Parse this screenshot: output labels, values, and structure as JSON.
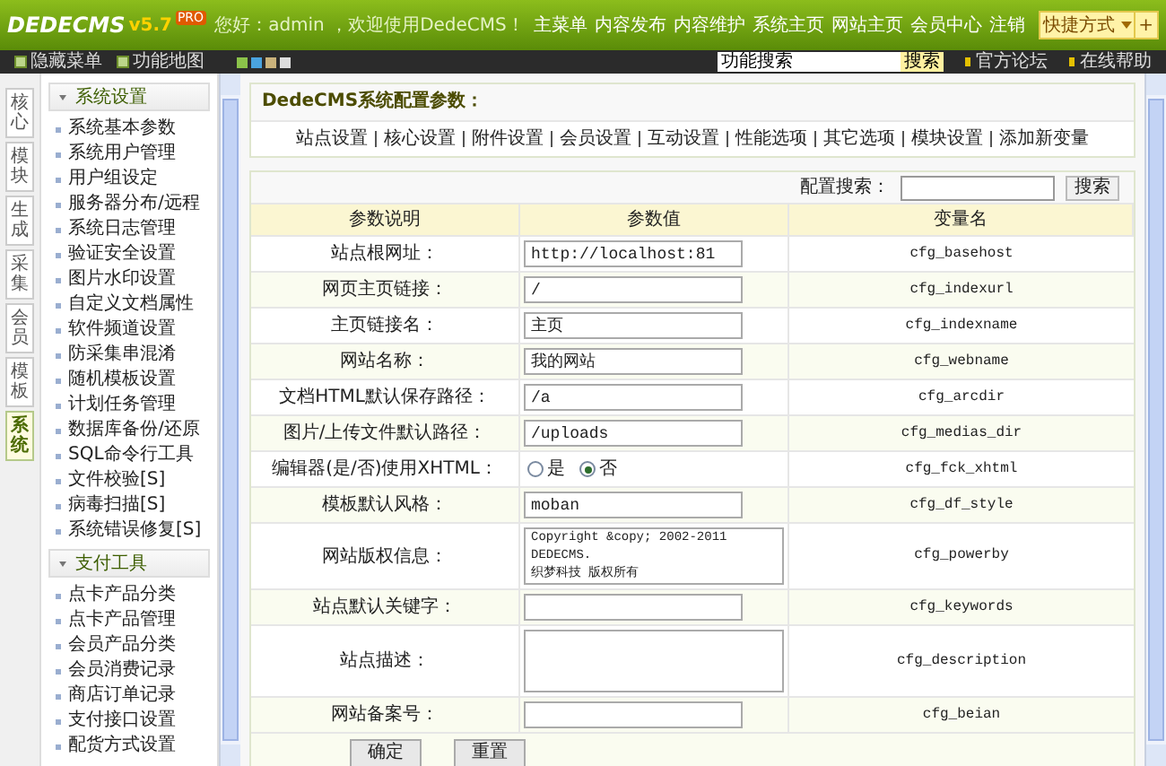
{
  "header": {
    "logo": "DEDECMS",
    "version": "v5.7",
    "edition": "PRO",
    "greeting": "您好：admin ，欢迎使用DedeCMS！",
    "nav": [
      "主菜单",
      "内容发布",
      "内容维护",
      "系统主页",
      "网站主页",
      "会员中心",
      "注销"
    ],
    "shortcut": "快捷方式",
    "shortcut_add": "+"
  },
  "toolbar": {
    "hide_menu": "隐藏菜单",
    "site_map": "功能地图",
    "search_value": "功能搜索",
    "search_button": "搜索",
    "links": [
      "官方论坛",
      "在线帮助"
    ]
  },
  "side_tabs": [
    {
      "label": "核心",
      "selected": false
    },
    {
      "label": "模块",
      "selected": false
    },
    {
      "label": "生成",
      "selected": false
    },
    {
      "label": "采集",
      "selected": false
    },
    {
      "label": "会员",
      "selected": false
    },
    {
      "label": "模板",
      "selected": false
    },
    {
      "label": "系统",
      "selected": true
    }
  ],
  "menu": [
    {
      "title": "系统设置",
      "expanded": true,
      "items": [
        "系统基本参数",
        "系统用户管理",
        "用户组设定",
        "服务器分布/远程",
        "系统日志管理",
        "验证安全设置",
        "图片水印设置",
        "自定义文档属性",
        "软件频道设置",
        "防采集串混淆",
        "随机模板设置",
        "计划任务管理",
        "数据库备份/还原",
        "SQL命令行工具",
        "文件校验[S]",
        "病毒扫描[S]",
        "系统错误修复[S]"
      ]
    },
    {
      "title": "支付工具",
      "expanded": true,
      "items": [
        "点卡产品分类",
        "点卡产品管理",
        "会员产品分类",
        "会员消费记录",
        "商店订单记录",
        "支付接口设置",
        "配货方式设置"
      ]
    }
  ],
  "main": {
    "title": "DedeCMS系统配置参数：",
    "tabs": [
      "站点设置",
      "核心设置",
      "附件设置",
      "会员设置",
      "互动设置",
      "性能选项",
      "其它选项",
      "模块设置",
      "添加新变量"
    ],
    "search_label": "配置搜索：",
    "search_button": "搜索",
    "columns": [
      "参数说明",
      "参数值",
      "变量名"
    ],
    "rows": [
      {
        "kind": "text",
        "label": "站点根网址：",
        "value": "http://localhost:81",
        "var": "cfg_basehost"
      },
      {
        "kind": "text",
        "label": "网页主页链接：",
        "value": "/",
        "var": "cfg_indexurl"
      },
      {
        "kind": "text",
        "label": "主页链接名：",
        "value": "主页",
        "var": "cfg_indexname"
      },
      {
        "kind": "text",
        "label": "网站名称：",
        "value": "我的网站",
        "var": "cfg_webname"
      },
      {
        "kind": "text",
        "label": "文档HTML默认保存路径：",
        "value": "/a",
        "var": "cfg_arcdir"
      },
      {
        "kind": "text",
        "label": "图片/上传文件默认路径：",
        "value": "/uploads",
        "var": "cfg_medias_dir"
      },
      {
        "kind": "radio",
        "label": "编辑器(是/否)使用XHTML：",
        "options": [
          {
            "label": "是",
            "selected": false
          },
          {
            "label": "否",
            "selected": true
          }
        ],
        "var": "cfg_fck_xhtml"
      },
      {
        "kind": "text",
        "label": "模板默认风格：",
        "value": "moban",
        "var": "cfg_df_style"
      },
      {
        "kind": "textarea",
        "label": "网站版权信息：",
        "value": "Copyright &copy; 2002-2011 DEDECMS.\n织梦科技 版权所有",
        "var": "cfg_powerby"
      },
      {
        "kind": "text",
        "label": "站点默认关键字：",
        "value": "",
        "var": "cfg_keywords"
      },
      {
        "kind": "textarea",
        "label": "站点描述：",
        "value": "",
        "var": "cfg_description"
      },
      {
        "kind": "text",
        "label": "网站备案号：",
        "value": "",
        "var": "cfg_beian"
      }
    ],
    "buttons": [
      "确定",
      "重置"
    ]
  }
}
